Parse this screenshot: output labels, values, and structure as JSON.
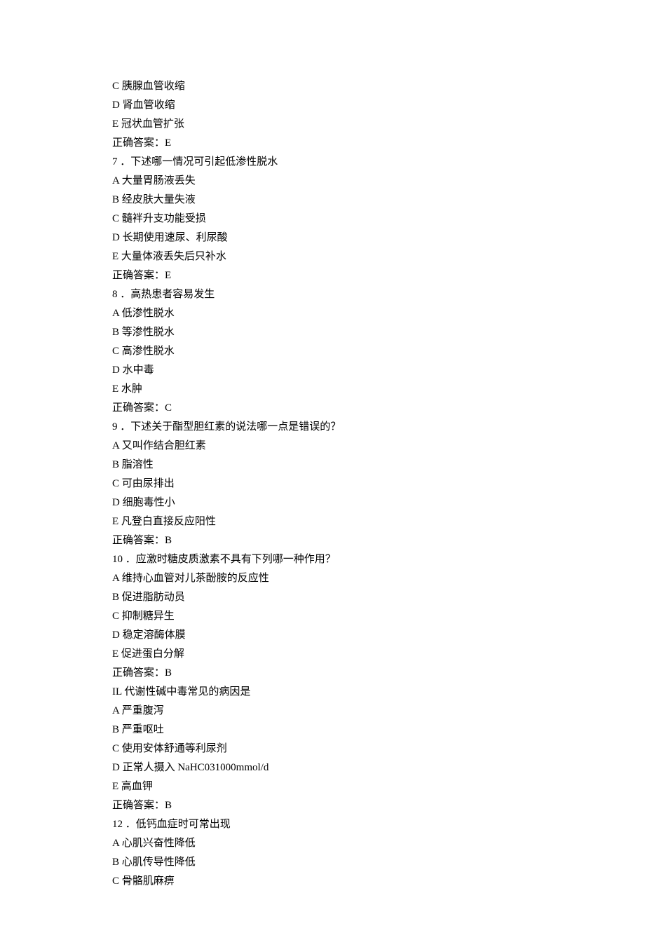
{
  "lines": [
    "C 胰腺血管收缩",
    "D 肾血管收缩",
    "E 冠状血管扩张",
    "正确答案：E",
    "7 ．下述哪一情况可引起低渗性脱水",
    "A 大量胃肠液丢失",
    "B 经皮肤大量失液",
    "C 髓袢升支功能受损",
    "D 长期使用速尿、利尿酸",
    "E 大量体液丢失后只补水",
    "正确答案：E",
    "8 ．高热患者容易发生",
    "A 低渗性脱水",
    "B 等渗性脱水",
    "C 高渗性脱水",
    "D 水中毒",
    "E 水肿",
    "正确答案：C",
    "9 ．下述关于酯型胆红素的说法哪一点是错误的？",
    "A 又叫作结合胆红素",
    "B 脂溶性",
    "C 可由尿排出",
    "D 细胞毒性小",
    "E 凡登白直接反应阳性",
    "正确答案：B",
    "10 ．应激时糖皮质激素不具有下列哪一种作用？",
    "A 维持心血管对儿茶酚胺的反应性",
    "B 促进脂肪动员",
    "C 抑制糖异生",
    "D 稳定溶酶体膜",
    "E 促进蛋白分解",
    "正确答案：B",
    "IL 代谢性碱中毒常见的病因是",
    "A 严重腹泻",
    "B 严重呕吐",
    "C 使用安体舒通等利尿剂",
    "D 正常人摄入 NaHC031000mmol/d",
    "E 高血钾",
    "正确答案：B",
    "12 ．低钙血症时可常出现",
    "A 心肌兴奋性降低",
    "B 心肌传导性降低",
    "C 骨骼肌麻痹"
  ]
}
